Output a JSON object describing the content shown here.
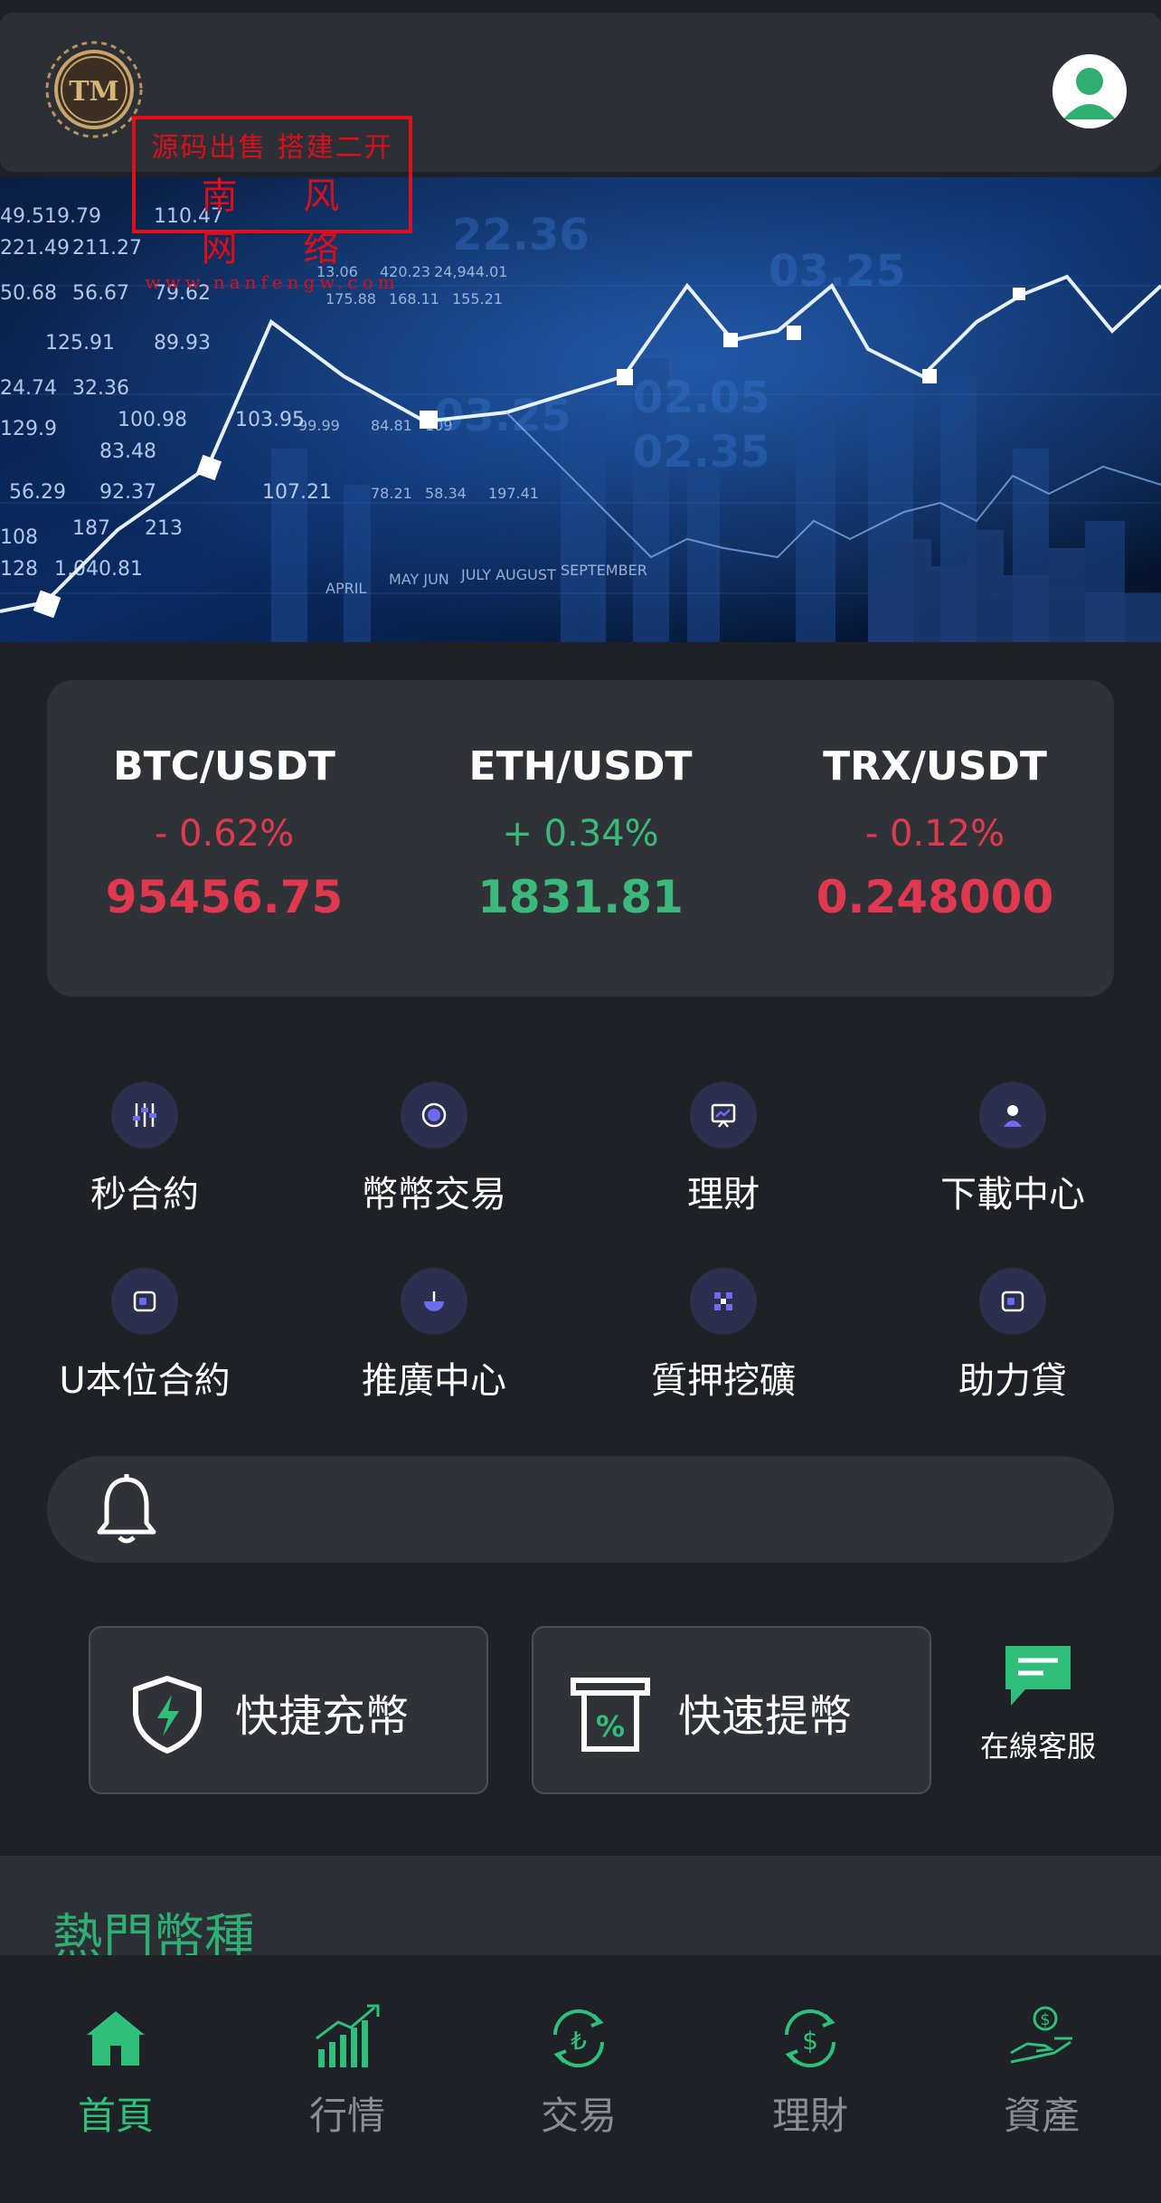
{
  "header": {
    "logo_text": "TM",
    "watermark": {
      "line1": "源码出售 搭建二开",
      "line2": "南 风 网 络",
      "line3": "www.nanfengw.com"
    }
  },
  "tickers": [
    {
      "pair": "BTC/USDT",
      "change": "- 0.62%",
      "price": "95456.75",
      "trend": "down"
    },
    {
      "pair": "ETH/USDT",
      "change": "+ 0.34%",
      "price": "1831.81",
      "trend": "up"
    },
    {
      "pair": "TRX/USDT",
      "change": "- 0.12%",
      "price": "0.248000",
      "trend": "down"
    }
  ],
  "features": [
    {
      "label": "秒合約",
      "icon": "sliders-icon"
    },
    {
      "label": "幣幣交易",
      "icon": "circle-icon"
    },
    {
      "label": "理財",
      "icon": "presentation-icon"
    },
    {
      "label": "下載中心",
      "icon": "user-download-icon"
    },
    {
      "label": "U本位合約",
      "icon": "wallet-icon"
    },
    {
      "label": "推廣中心",
      "icon": "promotion-icon"
    },
    {
      "label": "質押挖礦",
      "icon": "mining-icon"
    },
    {
      "label": "助力貸",
      "icon": "wallet-icon"
    }
  ],
  "quick": {
    "deposit_label": "快捷充幣",
    "withdraw_label": "快速提幣",
    "service_label": "在線客服"
  },
  "hot": {
    "title": "熱門幣種"
  },
  "tabs": [
    {
      "label": "首頁",
      "icon": "home-icon"
    },
    {
      "label": "行情",
      "icon": "market-chart-icon"
    },
    {
      "label": "交易",
      "icon": "exchange-icon"
    },
    {
      "label": "理財",
      "icon": "finance-icon"
    },
    {
      "label": "資產",
      "icon": "assets-icon"
    }
  ],
  "colors": {
    "background": "#1e2126",
    "card": "#2f3338",
    "accent_green": "#2fbf7a",
    "down_red": "#e0384f",
    "up_green": "#3bb97a"
  }
}
